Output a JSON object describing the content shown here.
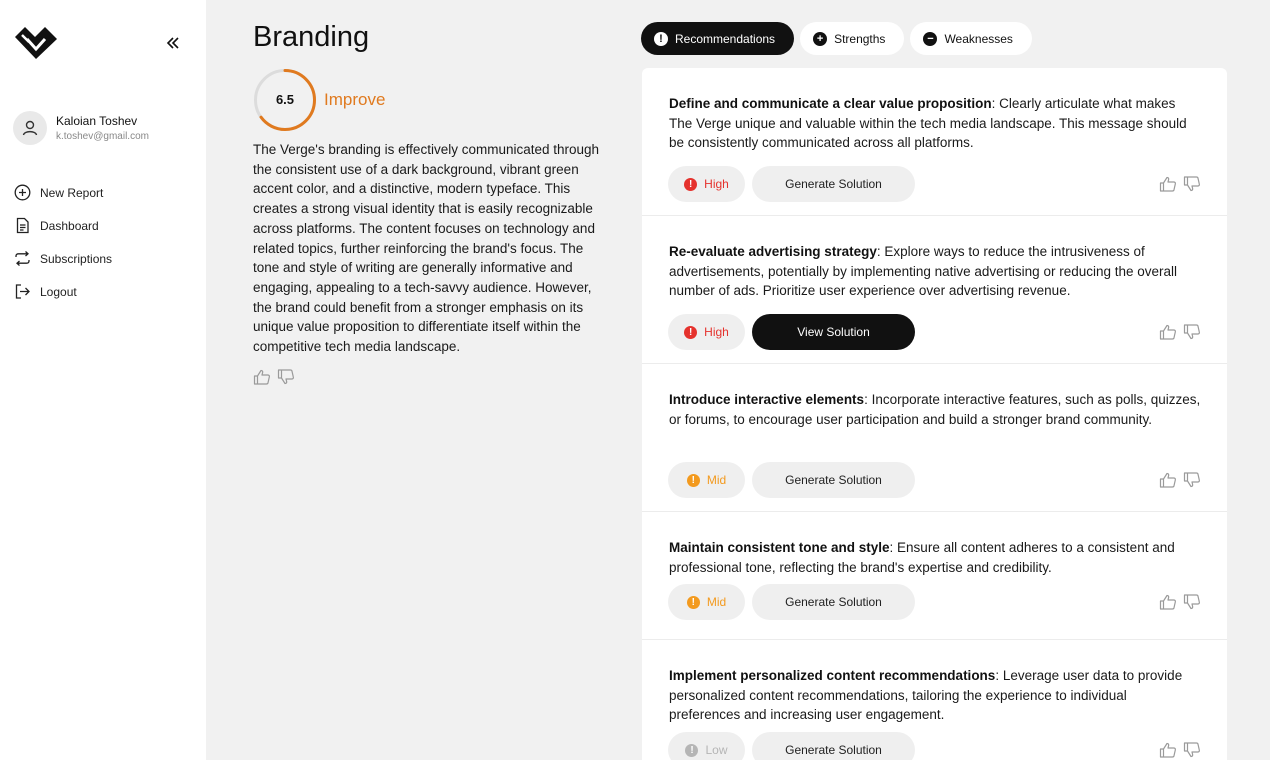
{
  "user": {
    "name": "Kaloian Toshev",
    "email": "k.toshev@gmail.com"
  },
  "nav": [
    {
      "label": "New Report",
      "icon": "plus-circle-icon"
    },
    {
      "label": "Dashboard",
      "icon": "document-icon"
    },
    {
      "label": "Subscriptions",
      "icon": "repeat-icon"
    },
    {
      "label": "Logout",
      "icon": "logout-icon"
    }
  ],
  "section": {
    "title": "Branding",
    "score": "6.5",
    "score_fraction": 0.65,
    "status": "Improve",
    "summary": "The Verge's branding is effectively communicated through the consistent use of a dark background, vibrant green accent color, and a distinctive, modern typeface. This creates a strong visual identity that is easily recognizable across platforms. The content focuses on technology and related topics, further reinforcing the brand's focus. The tone and style of writing are generally informative and engaging, appealing to a tech-savvy audience. However, the brand could benefit from a stronger emphasis on its unique value proposition to differentiate itself within the competitive tech media landscape."
  },
  "tabs": [
    {
      "label": "Recommendations",
      "icon": "!",
      "active": true
    },
    {
      "label": "Strengths",
      "icon": "+",
      "active": false
    },
    {
      "label": "Weaknesses",
      "icon": "−",
      "active": false
    }
  ],
  "recommendations": [
    {
      "title": "Define and communicate a clear value proposition",
      "text": ": Clearly articulate what makes The Verge unique and valuable within the tech media landscape. This message should be consistently communicated across all platforms.",
      "priority": "High",
      "priority_color": "#e5322d",
      "action": "Generate Solution"
    },
    {
      "title": "Re-evaluate advertising strategy",
      "text": ": Explore ways to reduce the intrusiveness of advertisements, potentially by implementing native advertising or reducing the overall number of ads. Prioritize user experience over advertising revenue.",
      "priority": "High",
      "priority_color": "#e5322d",
      "action": "View Solution"
    },
    {
      "title": "Introduce interactive elements",
      "text": ": Incorporate interactive features, such as polls, quizzes, or forums, to encourage user participation and build a stronger brand community.",
      "priority": "Mid",
      "priority_color": "#f39a1e",
      "action": "Generate Solution"
    },
    {
      "title": "Maintain consistent tone and style",
      "text": ": Ensure all content adheres to a consistent and professional tone, reflecting the brand's expertise and credibility.",
      "priority": "Mid",
      "priority_color": "#f39a1e",
      "action": "Generate Solution"
    },
    {
      "title": "Implement personalized content recommendations",
      "text": ": Leverage user data to provide personalized content recommendations, tailoring the experience to individual preferences and increasing user engagement.",
      "priority": "Low",
      "priority_color": "#b5b5b5",
      "action": "Generate Solution"
    }
  ],
  "colors": {
    "accent": "#e07a1f",
    "high": "#e5322d",
    "mid": "#f39a1e",
    "low": "#b5b5b5"
  }
}
